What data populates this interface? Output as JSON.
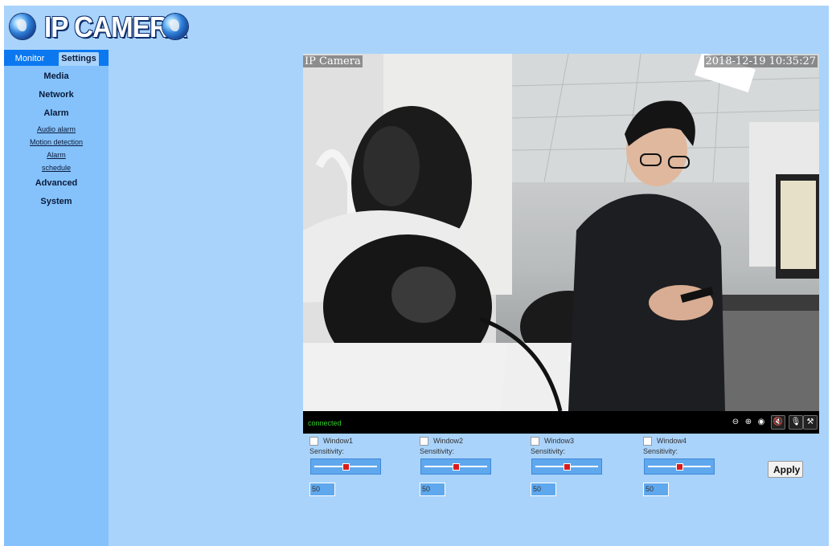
{
  "header": {
    "title": "IP CAMERA",
    "icons": [
      "globe-icon",
      "globe-icon"
    ]
  },
  "tabs": {
    "monitor": "Monitor",
    "settings": "Settings"
  },
  "menu": {
    "media": "Media",
    "network": "Network",
    "alarm": "Alarm",
    "alarm_sub": {
      "audio_alarm": "Audio alarm",
      "motion_detection": "Motion detection",
      "alarm": "Alarm",
      "schedule": "schedule"
    },
    "advanced": "Advanced",
    "system": "System"
  },
  "video": {
    "overlay_title": "IP Camera",
    "timestamp": "2018-12-19 10:35:27",
    "status": "connected",
    "controls": [
      "zoom-out-icon",
      "zoom-in-icon",
      "record-icon",
      "mute-icon",
      "mic-off-icon",
      "settings-tool-icon"
    ]
  },
  "motion": {
    "windows": [
      {
        "label": "Window1",
        "sensitivity_label": "Sensitivity:",
        "value": "50",
        "level": 0.5
      },
      {
        "label": "Window2",
        "sensitivity_label": "Sensitivity:",
        "value": "50",
        "level": 0.5
      },
      {
        "label": "Window3",
        "sensitivity_label": "Sensitivity:",
        "value": "50",
        "level": 0.5
      },
      {
        "label": "Window4",
        "sensitivity_label": "Sensitivity:",
        "value": "50",
        "level": 0.5
      }
    ],
    "apply_label": "Apply"
  },
  "colors": {
    "page_bg": "#a9d3fb",
    "sidebar_bg": "#85c2fb",
    "tab_bar": "#0b78f0",
    "status_green": "#35d12c",
    "slider_thumb": "#d81c1c"
  }
}
